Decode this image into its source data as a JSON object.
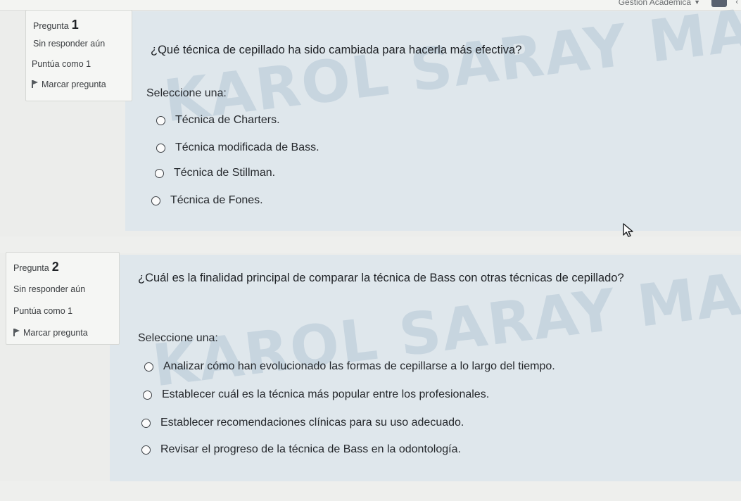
{
  "header": {
    "menu_label": "Gestión Académica"
  },
  "questions": [
    {
      "label": "Pregunta",
      "number": "1",
      "status": "Sin responder aún",
      "score": "Puntúa como 1",
      "flag_label": "Marcar pregunta",
      "text": "¿Qué técnica de cepillado ha sido cambiada para hacerla más efectiva?",
      "prompt": "Seleccione una:",
      "options": [
        "Técnica de Charters.",
        "Técnica modificada de Bass.",
        "Técnica de Stillman.",
        "Técnica de Fones."
      ],
      "watermark": "KAROL SARAY MARIN CA"
    },
    {
      "label": "Pregunta",
      "number": "2",
      "status": "Sin responder aún",
      "score": "Puntúa como 1",
      "flag_label": "Marcar pregunta",
      "text": "¿Cuál es la finalidad principal de comparar la técnica de Bass con otras técnicas de cepillado?",
      "prompt": "Seleccione una:",
      "options": [
        "Analizar cómo han evolucionado las formas de cepillarse a lo largo del tiempo.",
        "Establecer cuál es la técnica más popular entre los profesionales.",
        "Establecer recomendaciones clínicas para su uso adecuado.",
        "Revisar el progreso de la técnica de Bass en la odontología."
      ],
      "watermark": "KAROL SARAY MARIN CA"
    }
  ]
}
